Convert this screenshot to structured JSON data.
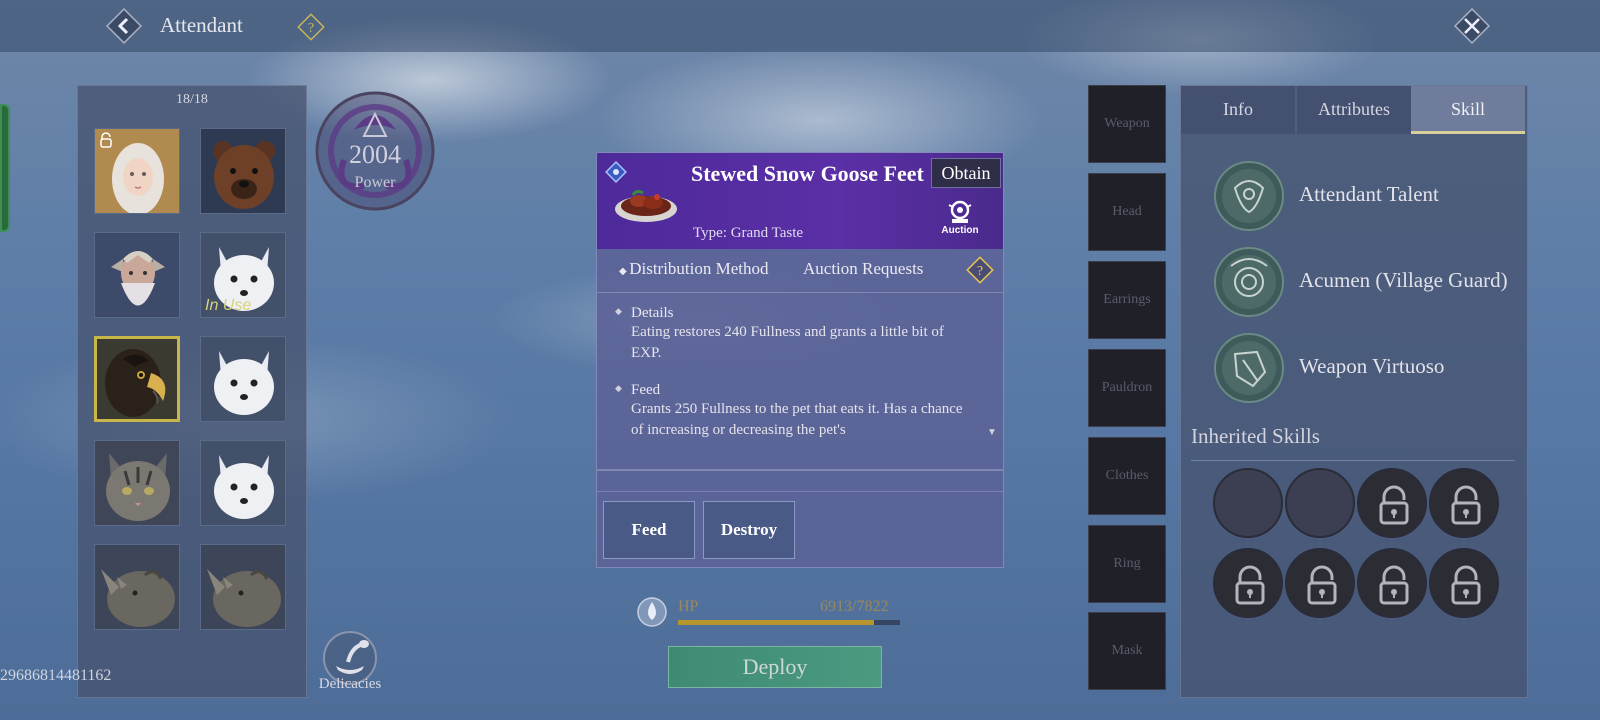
{
  "header": {
    "title": "Attendant"
  },
  "roster": {
    "count": "18/18",
    "in_use_label": "In Use",
    "slots": [
      {
        "name": "white-haired-woman",
        "selected": false,
        "locked": true
      },
      {
        "name": "bear",
        "selected": false
      },
      {
        "name": "elf-elder",
        "selected": false
      },
      {
        "name": "white-fox",
        "selected": false,
        "in_use": true
      },
      {
        "name": "eagle",
        "selected": true
      },
      {
        "name": "white-fox",
        "selected": false
      },
      {
        "name": "wildcat",
        "selected": false
      },
      {
        "name": "white-fox",
        "selected": false
      },
      {
        "name": "rhino",
        "selected": false
      },
      {
        "name": "rhino",
        "selected": false
      }
    ]
  },
  "power": {
    "value": "2004",
    "label": "Power"
  },
  "player_id": "29686814481162",
  "delicacies_label": "Delicacies",
  "item_popup": {
    "name": "Stewed Snow Goose Feet",
    "obtain_label": "Obtain",
    "type": "Type: Grand Taste",
    "auction_label": "Auction",
    "tabs": {
      "distribution": "Distribution Method",
      "auction_requests": "Auction Requests"
    },
    "details_title": "Details",
    "details_text": "Eating restores 240 Fullness and grants a little bit of EXP.",
    "feed_title": "Feed",
    "feed_text": "Grants 250 Fullness to the pet that eats it. Has a chance of increasing or decreasing the pet's",
    "feed_button": "Feed",
    "destroy_button": "Destroy",
    "header_color": "#5b2fa6"
  },
  "hp": {
    "label": "HP",
    "value": "6913/7822",
    "fraction": 0.884
  },
  "deploy_label": "Deploy",
  "equipment": [
    "Weapon",
    "Head",
    "Earrings",
    "Pauldron",
    "Clothes",
    "Ring",
    "Mask"
  ],
  "right_panel": {
    "tabs": [
      "Info",
      "Attributes",
      "Skill"
    ],
    "active_tab": "Skill",
    "skills": [
      "Attendant Talent",
      "Acumen (Village Guard)",
      "Weapon Virtuoso"
    ],
    "inherited_title": "Inherited Skills",
    "inherited_slots": [
      "empty",
      "empty",
      "locked",
      "locked",
      "locked",
      "locked",
      "locked",
      "locked"
    ]
  },
  "colors": {
    "accent_gold": "#c9b64a",
    "deploy_green": "#4b9a80",
    "hp_gold": "#b6952c"
  }
}
